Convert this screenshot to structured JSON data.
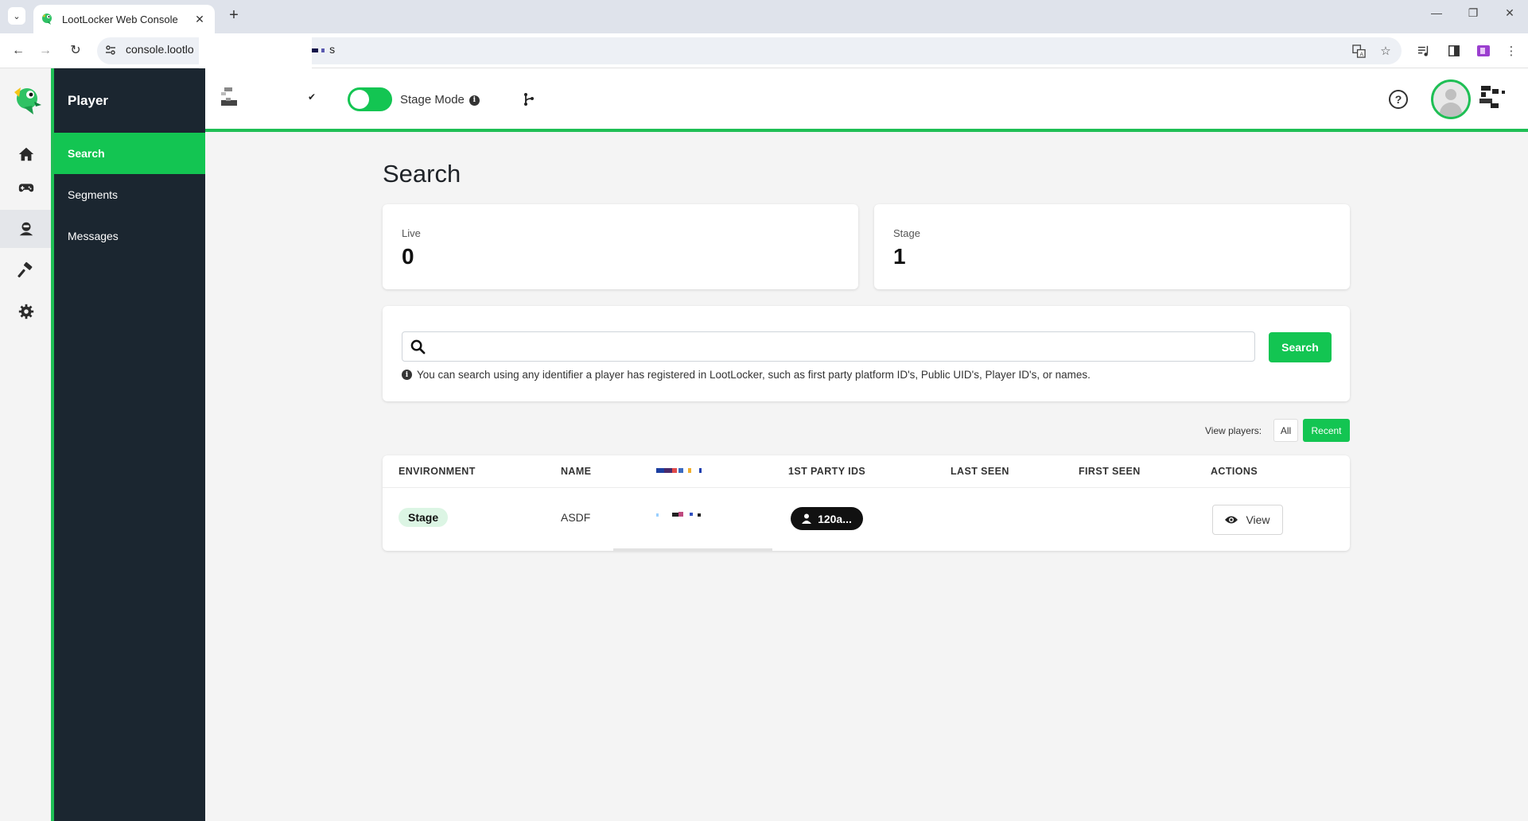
{
  "browser": {
    "tab_title": "LootLocker Web Console",
    "url": "console.lootlo",
    "url_tail": "s",
    "new_tab": "+",
    "close_tab": "✕",
    "back": "←",
    "forward": "→",
    "reload": "↻",
    "window_controls": {
      "minimize": "—",
      "restore": "❐",
      "close": "✕"
    }
  },
  "rail": {
    "items": [
      {
        "icon": "home-icon"
      },
      {
        "icon": "gamepad-icon"
      },
      {
        "icon": "layers-icon"
      },
      {
        "icon": "player-icon",
        "active": true
      },
      {
        "icon": "hammer-icon"
      },
      {
        "icon": "gear-icon"
      }
    ]
  },
  "subnav": {
    "heading": "Player",
    "items": [
      {
        "label": "Search",
        "active": true
      },
      {
        "label": "Segments"
      },
      {
        "label": "Messages"
      }
    ]
  },
  "topbar": {
    "stage_mode_label": "Stage Mode",
    "stage_mode_on": true,
    "help": "?"
  },
  "main": {
    "title": "Search",
    "stats": [
      {
        "label": "Live",
        "value": "0"
      },
      {
        "label": "Stage",
        "value": "1"
      }
    ],
    "search": {
      "placeholder": "",
      "button": "Search",
      "hint": "You can search using any identifier a player has registered in LootLocker, such as first party platform ID's, Public UID's, Player ID's, or names."
    },
    "view_players": {
      "label": "View players:",
      "options": [
        "All",
        "Recent"
      ],
      "selected": "Recent"
    },
    "table": {
      "columns": [
        "ENVIRONMENT",
        "NAME",
        "1ST PARTY IDS",
        "LAST SEEN",
        "FIRST SEEN",
        "ACTIONS"
      ],
      "rows": [
        {
          "environment": "Stage",
          "name": "ASDF",
          "first_party_id": "120a...",
          "last_seen": "",
          "first_seen": "",
          "action": "View"
        }
      ]
    }
  },
  "colors": {
    "brand_green": "#13c552",
    "sidebar_dark": "#1b2630",
    "badge_green_bg": "#dcf5e4"
  }
}
